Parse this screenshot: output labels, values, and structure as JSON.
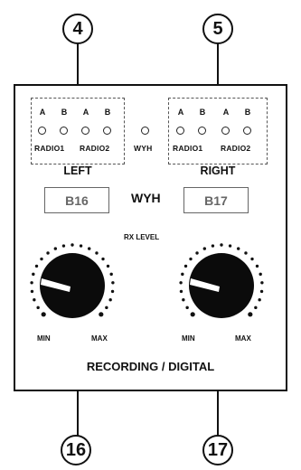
{
  "callouts": {
    "top_left": "4",
    "top_right": "5",
    "bottom_left": "16",
    "bottom_right": "17"
  },
  "left_group": {
    "letters": [
      "A",
      "B",
      "A",
      "B"
    ],
    "radio1": "RADIO1",
    "radio2": "RADIO2",
    "label": "LEFT"
  },
  "right_group": {
    "letters": [
      "A",
      "B",
      "A",
      "B"
    ],
    "radio1": "RADIO1",
    "radio2": "RADIO2",
    "label": "RIGHT"
  },
  "wyh_led_label": "WYH",
  "channels": {
    "left": "B16",
    "middle": "WYH",
    "right": "B17"
  },
  "rx_level": "RX LEVEL",
  "knob_left": {
    "min": "MIN",
    "max": "MAX"
  },
  "knob_right": {
    "min": "MIN",
    "max": "MAX"
  },
  "footer": "RECORDING / DIGITAL"
}
